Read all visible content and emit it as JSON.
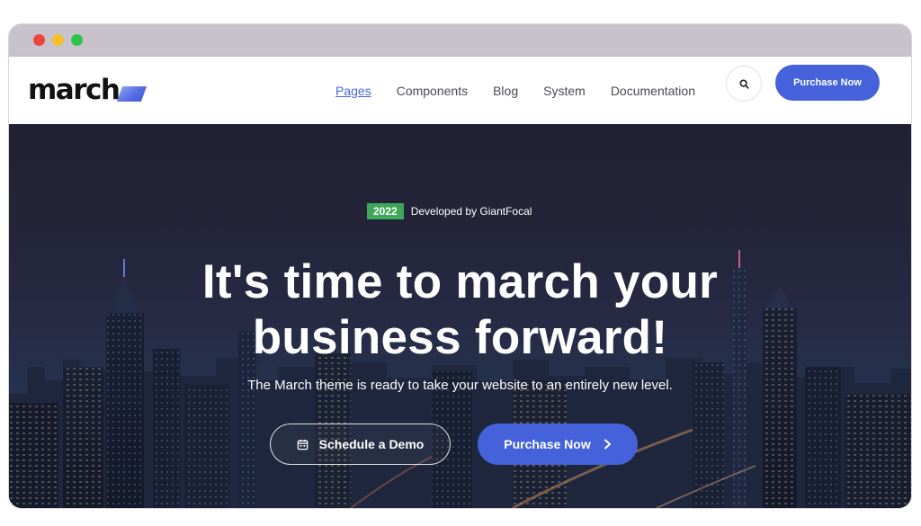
{
  "window": {
    "controls": [
      "close",
      "minimize",
      "maximize"
    ]
  },
  "header": {
    "logo_text": "march",
    "nav": [
      {
        "label": "Pages",
        "active": true
      },
      {
        "label": "Components",
        "active": false
      },
      {
        "label": "Blog",
        "active": false
      },
      {
        "label": "System",
        "active": false
      },
      {
        "label": "Documentation",
        "active": false
      }
    ],
    "search_icon": "search-icon",
    "purchase_label": "Purchase Now"
  },
  "hero": {
    "badge_year": "2022",
    "developer_text": "Developed by GiantFocal",
    "headline_line1": "It's time to march your",
    "headline_line2": "business forward!",
    "subtitle": "The March theme is ready to take your website to an entirely new level.",
    "demo_button_label": "Schedule a Demo",
    "demo_button_icon": "calendar-icon",
    "purchase_button_label": "Purchase Now",
    "purchase_button_icon": "chevron-right-icon"
  },
  "colors": {
    "accent": "#4562db",
    "badge_green": "#3fa65a",
    "active_nav": "#4a66dc",
    "titlebar": "#c7c2cc"
  }
}
